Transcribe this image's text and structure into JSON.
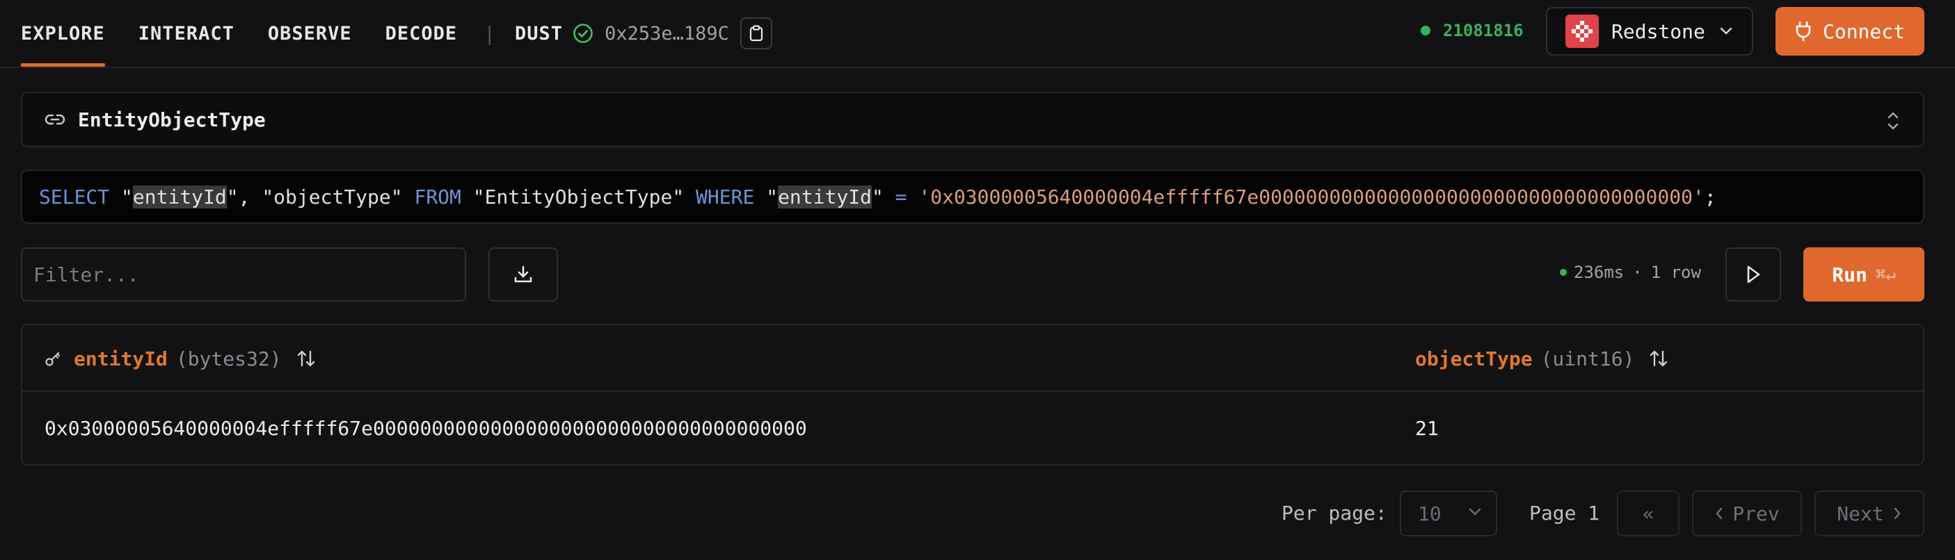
{
  "nav": {
    "items": [
      "EXPLORE",
      "INTERACT",
      "OBSERVE",
      "DECODE"
    ],
    "separator": "|",
    "world_name": "DUST",
    "world_address": "0x253e…189C"
  },
  "status": {
    "block_number": "21081816",
    "chain_name": "Redstone",
    "connect_label": "Connect"
  },
  "table_selector": {
    "value": "EntityObjectType"
  },
  "query": {
    "select_kw": "SELECT",
    "col1": "\"entityId\"",
    "col2": "\"objectType\"",
    "from_kw": "FROM",
    "table": "\"EntityObjectType\"",
    "where_kw": "WHERE",
    "where_col": "\"entityId\"",
    "op": "=",
    "literal": "'0x03000005640000004efffff67e0000000000000000000000000000000000000'",
    "terminator": ";"
  },
  "toolbar": {
    "filter_placeholder": "Filter...",
    "stats_time": "236ms",
    "stats_sep": "·",
    "stats_rows": "1 row",
    "run_label": "Run",
    "run_shortcut": "⌘↵"
  },
  "results": {
    "columns": [
      {
        "name": "entityId",
        "type": "(bytes32)"
      },
      {
        "name": "objectType",
        "type": "(uint16)"
      }
    ],
    "rows": [
      [
        "0x03000005640000004efffff67e0000000000000000000000000000000000000",
        "21"
      ]
    ]
  },
  "pagination": {
    "per_page_label": "Per page:",
    "per_page_value": "10",
    "page_label": "Page 1",
    "first_label": "«",
    "prev_label": "Prev",
    "next_label": "Next"
  },
  "colors": {
    "accent": "#e0682e",
    "success": "#38b25a",
    "keyword": "#6b96d6",
    "literal": "#d99f7c"
  }
}
